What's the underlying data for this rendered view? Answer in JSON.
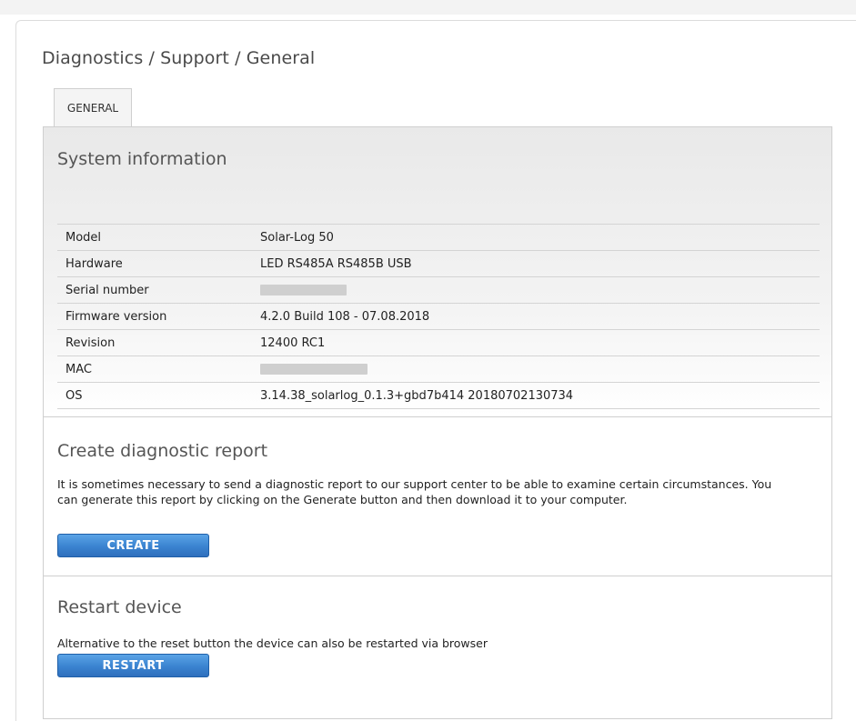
{
  "breadcrumb": "Diagnostics / Support / General",
  "tabs": [
    {
      "label": "GENERAL"
    }
  ],
  "system_info": {
    "title": "System information",
    "rows": [
      {
        "label": "Model",
        "value": "Solar-Log 50"
      },
      {
        "label": "Hardware",
        "value": "LED RS485A RS485B USB"
      },
      {
        "label": "Serial number",
        "value": ""
      },
      {
        "label": "Firmware version",
        "value": "4.2.0 Build 108 - 07.08.2018"
      },
      {
        "label": "Revision",
        "value": "12400 RC1"
      },
      {
        "label": "MAC",
        "value": ""
      },
      {
        "label": "OS",
        "value": "3.14.38_solarlog_0.1.3+gbd7b414 20180702130734"
      }
    ]
  },
  "diagnostic": {
    "title": "Create diagnostic report",
    "description": "It is sometimes necessary to send a diagnostic report to our support center to be able to examine certain circumstances. You can generate this report by clicking on the Generate button and then download it to your computer.",
    "button_label": "CREATE"
  },
  "restart": {
    "title": "Restart device",
    "description": "Alternative to the reset button the device can also be restarted via browser",
    "button_label": "RESTART"
  },
  "colors": {
    "button": "#3a83d0",
    "button_border": "#1f5fa8"
  }
}
